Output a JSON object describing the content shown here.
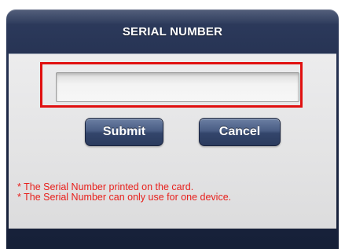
{
  "dialog": {
    "title": "SERIAL NUMBER"
  },
  "form": {
    "serial_value": "",
    "serial_placeholder": ""
  },
  "buttons": {
    "submit_label": "Submit",
    "cancel_label": "Cancel"
  },
  "notes": [
    "* The Serial Number printed on the card.",
    "* The Serial Number can only use for one device."
  ],
  "colors": {
    "header_bg": "#1d2846",
    "panel_bg": "#e3e3e4",
    "button_bg": "#3a4c72",
    "note_text": "#e8201c",
    "highlight_frame": "#e01010"
  }
}
